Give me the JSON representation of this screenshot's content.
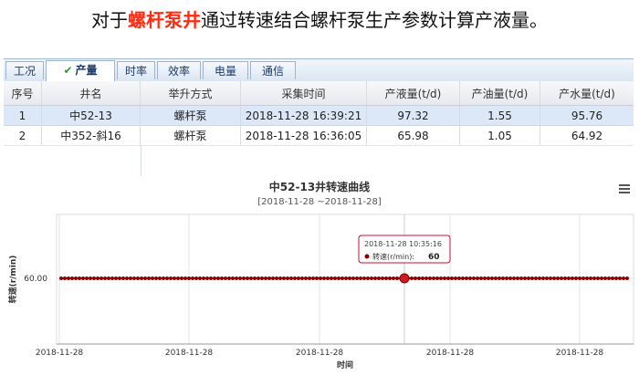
{
  "heading": {
    "before": "对于",
    "highlight": "螺杆泵井",
    "after": "通过转速结合螺杆泵生产参数计算产液量。"
  },
  "tabs": [
    {
      "label": "工况",
      "active": false
    },
    {
      "label": "产量",
      "active": true
    },
    {
      "label": "时率",
      "active": false
    },
    {
      "label": "效率",
      "active": false
    },
    {
      "label": "电量",
      "active": false
    },
    {
      "label": "通信",
      "active": false
    }
  ],
  "table": {
    "columns": [
      "序号",
      "井名",
      "举升方式",
      "采集时间",
      "产液量(t/d)",
      "产油量(t/d)",
      "产水量(t/d)"
    ],
    "rows": [
      [
        "1",
        "中52-13",
        "螺杆泵",
        "2018-11-28 16:39:21",
        "97.32",
        "1.55",
        "95.76"
      ],
      [
        "2",
        "中352-斜16",
        "螺杆泵",
        "2018-11-28 16:36:05",
        "65.98",
        "1.05",
        "64.92"
      ]
    ]
  },
  "chart": {
    "menu_icon": "hamburger-menu-icon",
    "tooltip": {
      "time": "2018-11-28 10:35:16",
      "series": "转速(r/min):",
      "value": "60"
    }
  },
  "chart_data": {
    "type": "line",
    "title": "中52-13井转速曲线",
    "subtitle": "[2018-11-28 ~2018-11-28]",
    "xlabel": "时间",
    "ylabel": "转速(r/min)",
    "x_ticks": [
      "2018-11-28",
      "2018-11-28",
      "2018-11-28",
      "2018-11-28",
      "2018-11-28"
    ],
    "y_ticks": [
      "60.00"
    ],
    "y_value": 60,
    "series": [
      {
        "name": "转速(r/min)",
        "color": "#8b0000"
      }
    ],
    "highlight_point": {
      "x": "2018-11-28 10:35:16",
      "y": 60
    },
    "grid": true
  }
}
